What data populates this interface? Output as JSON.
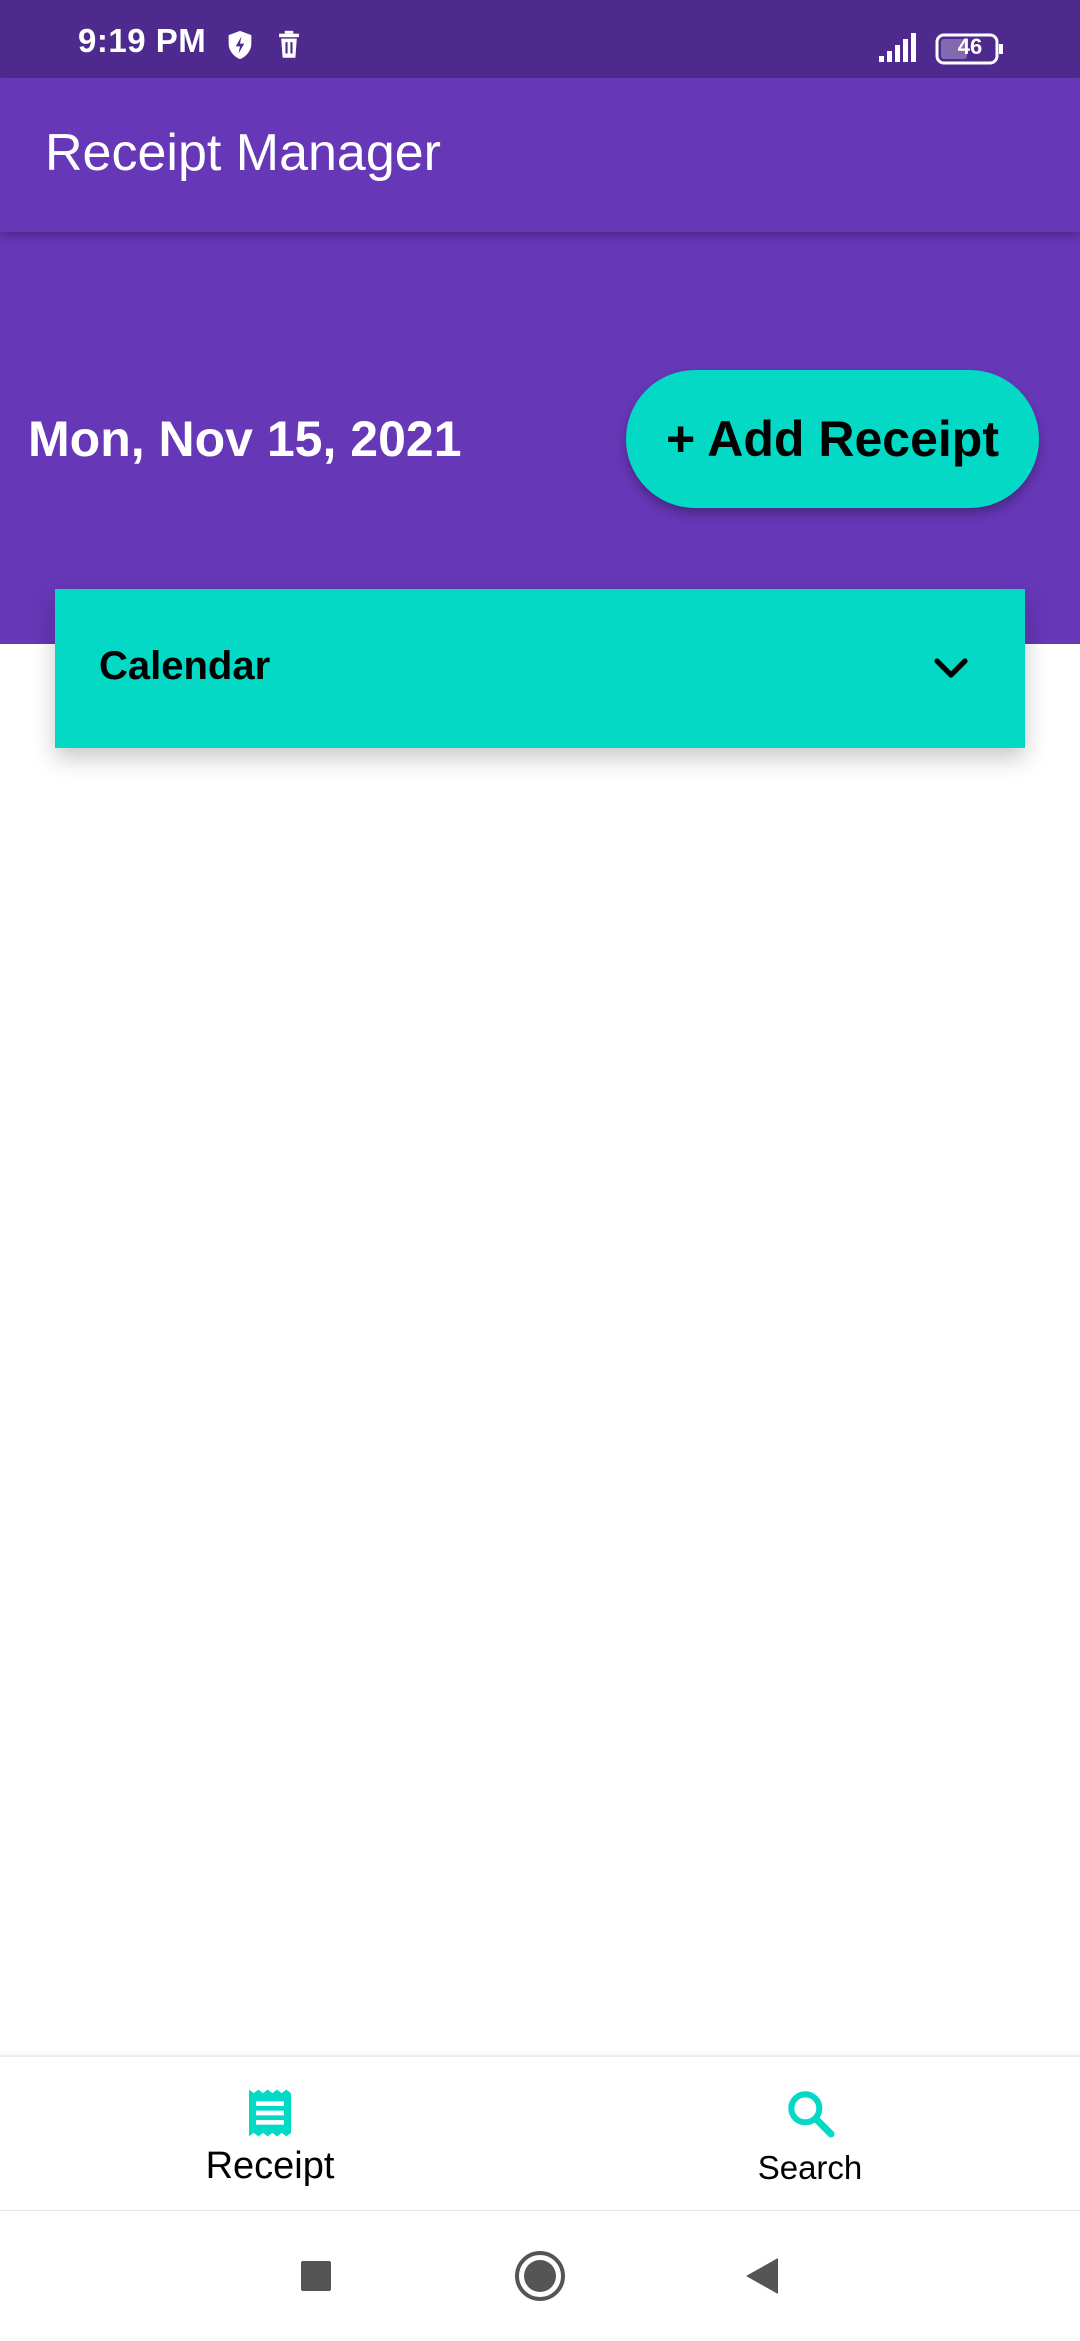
{
  "status_bar": {
    "time": "9:19 PM",
    "left_icons": [
      "shield-bolt-icon",
      "trash-icon"
    ],
    "signal_icon": "signal-icon",
    "battery_level": "46",
    "background_color": "#4e2a8e"
  },
  "app_bar": {
    "title": "Receipt Manager",
    "background_color": "#6637b7"
  },
  "header": {
    "date": "Mon, Nov 15, 2021",
    "add_receipt_label": "+ Add Receipt",
    "accent_color": "#03d9c5"
  },
  "calendar": {
    "label": "Calendar",
    "icon": "chevron-down-icon",
    "expanded": false
  },
  "bottom_nav": {
    "items": [
      {
        "label": "Receipt",
        "icon": "receipt-icon",
        "selected": true
      },
      {
        "label": "Search",
        "icon": "search-icon",
        "selected": false
      }
    ]
  },
  "system_nav": {
    "icons": [
      "recents-square-icon",
      "home-circle-icon",
      "back-triangle-icon"
    ]
  }
}
